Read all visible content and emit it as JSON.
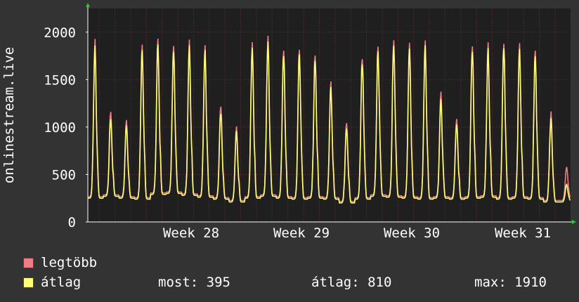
{
  "chart_data": {
    "type": "line",
    "ylabel": "onlinestream.live",
    "ylim": [
      0,
      2250
    ],
    "yticks": [
      0,
      500,
      1000,
      1500,
      2000
    ],
    "x_tick_labels": [
      "Week 28",
      "Week 29",
      "Week 30",
      "Week 31"
    ],
    "grid": true,
    "colors": {
      "background": "#333333",
      "plot": "#1f1f1f",
      "grid": "#6b2d2d",
      "axis": "#ffffff",
      "arrow": "#22cc22"
    },
    "series": [
      {
        "name": "legtöbb",
        "color": "#f07c86"
      },
      {
        "name": "átlag",
        "color": "#ffff77"
      }
    ],
    "daily_peaks": {
      "max": [
        1910,
        1180,
        1070,
        1890,
        1920,
        1910,
        1920,
        1840,
        1250,
        1010,
        1890,
        1950,
        1850,
        1860,
        1800,
        1500,
        1060,
        1760,
        1880,
        1970,
        1870,
        1890,
        1380,
        1110,
        1900,
        1890,
        1920,
        1850,
        1820,
        1150,
        580
      ],
      "avg": [
        1840,
        1100,
        1010,
        1830,
        1860,
        1850,
        1860,
        1790,
        1170,
        960,
        1830,
        1890,
        1790,
        1810,
        1740,
        1440,
        1000,
        1700,
        1830,
        1910,
        1810,
        1840,
        1300,
        1050,
        1840,
        1830,
        1870,
        1790,
        1760,
        1080,
        395
      ]
    },
    "daily_troughs": [
      250,
      270,
      250,
      240,
      290,
      300,
      280,
      260,
      240,
      210,
      250,
      270,
      250,
      240,
      250,
      240,
      200,
      240,
      270,
      260,
      250,
      240,
      250,
      240,
      250,
      260,
      240,
      250,
      240,
      210,
      210
    ]
  },
  "legend": {
    "max_label": "legtöbb",
    "avg_label": "átlag",
    "most": "most: 395",
    "avg": "átlag: 810",
    "max": "max: 1910"
  }
}
